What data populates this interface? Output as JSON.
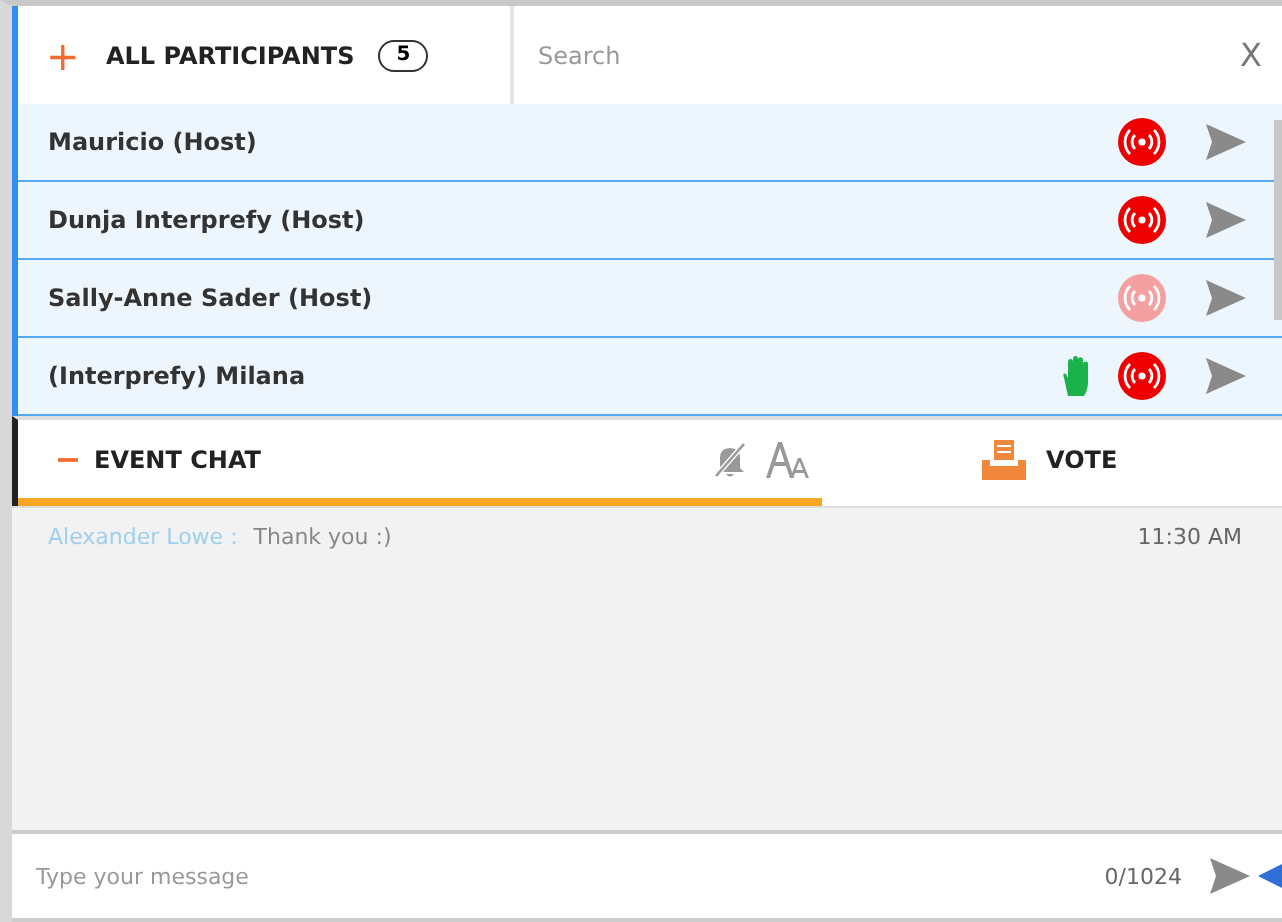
{
  "participants": {
    "toggle": "+",
    "title": "ALL PARTICIPANTS",
    "count": "5",
    "search": {
      "placeholder": "Search"
    },
    "close": "X",
    "items": [
      {
        "name": "Mauricio (Host)",
        "live": true,
        "hand_raised": false
      },
      {
        "name": "Dunja Interprefy (Host)",
        "live": true,
        "hand_raised": false
      },
      {
        "name": "Sally-Anne Sader (Host)",
        "live": false,
        "hand_raised": false
      },
      {
        "name": "(Interprefy) Milana",
        "live": true,
        "hand_raised": true
      }
    ]
  },
  "tabs": [
    {
      "toggle": "−",
      "label": "EVENT CHAT",
      "kind": "chat",
      "selected": true
    },
    {
      "label": "VOTE",
      "kind": "vote",
      "selected": false
    }
  ],
  "messages": [
    {
      "sender": "Alexander Lowe :",
      "text": "Thank you :)",
      "time": "11:30 AM"
    }
  ],
  "composer": {
    "placeholder": "Type your message",
    "counter": "0/1024"
  }
}
